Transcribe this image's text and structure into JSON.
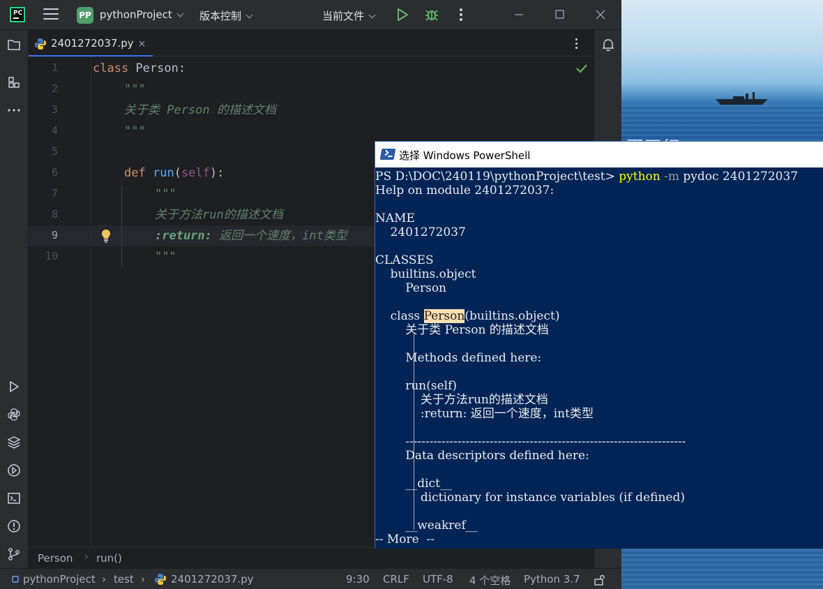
{
  "wallpaper": {
    "text": "蛋平行"
  },
  "titlebar": {
    "logo": "PC",
    "project_badge": "PP",
    "project_name": "pythonProject",
    "vcs_menu": "版本控制",
    "run_config": "当前文件",
    "icons": [
      "hamburger-menu-icon",
      "run-icon",
      "debug-icon",
      "more-icon",
      "minimize-icon",
      "maximize-icon",
      "close-icon"
    ]
  },
  "left_toolbar": [
    "folder-icon",
    "structure-icon",
    "more-icon",
    "run-icon",
    "python-console-icon",
    "layers-icon",
    "services-icon",
    "terminal-icon",
    "problems-icon",
    "git-icon"
  ],
  "right_toolbar": [
    "notifications-icon"
  ],
  "tabs": [
    {
      "label": "2401272037.py",
      "close": "×"
    }
  ],
  "editor": {
    "line_numbers": [
      "1",
      "2",
      "3",
      "4",
      "5",
      "6",
      "7",
      "8",
      "9",
      "10"
    ],
    "current_line": "9",
    "lines": {
      "l1_kw": "class",
      "l1_name": " Person:",
      "l2": "\"\"\"",
      "l3": "关于类 Person 的描述文档",
      "l4": "\"\"\"",
      "l6_kw": "def",
      "l6_fn": "run",
      "l6_open": "(",
      "l6_self": "self",
      "l6_close": "):",
      "l7": "\"\"\"",
      "l8": "关于方法run的描述文档",
      "l9_tag": ":return:",
      "l9_text": " 返回一个速度，int类型",
      "l10": "\"\"\""
    }
  },
  "breadcrumb": {
    "class": "Person",
    "sep": "›",
    "method": "run()"
  },
  "statusbar": {
    "project": "pythonProject",
    "folder": "test",
    "file": "2401272037.py",
    "sep": "›",
    "position": "9:30",
    "line_ending": "CRLF",
    "encoding": "UTF-8",
    "indent": "4 个空格",
    "interpreter": "Python 3.7"
  },
  "powershell": {
    "title": "选择 Windows PowerShell",
    "prompt": "PS D:\\DOC\\240119\\pythonProject\\test> ",
    "cmd": "python",
    "flag": " -m",
    "args": " pydoc 2401272037",
    "lines": {
      "help": "Help on module 2401272037:",
      "name_h": "NAME",
      "name_v": "    2401272037",
      "classes_h": "CLASSES",
      "builtins": "    builtins.object",
      "person": "        Person",
      "class_pre": "    class ",
      "class_hl": "Person",
      "class_post": "(builtins.object)",
      "class_doc": "        关于类 Person 的描述文档",
      "methods": "        Methods defined here:",
      "run": "        run(self)",
      "run_doc": "            关于方法run的描述文档",
      "run_ret": "            :return: 返回一个速度，int类型",
      "rule": "        ----------------------------------------------------------------------",
      "data_desc": "        Data descriptors defined here:",
      "dict": "        __dict__",
      "dict_doc": "            dictionary for instance variables (if defined)",
      "weakref": "        __weakref__",
      "more": "-- More  --"
    }
  }
}
